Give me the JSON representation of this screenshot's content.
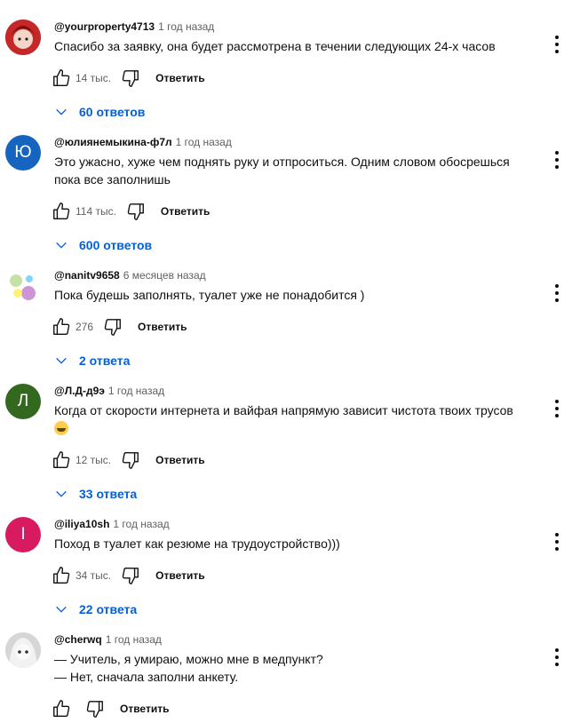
{
  "ui": {
    "reply_label": "Ответить"
  },
  "colors": {
    "link": "#065fd4",
    "muted": "#606060"
  },
  "comments": [
    {
      "author": "@yourproperty4713",
      "time": "1 год назад",
      "text": "Спасибо за заявку, она будет рассмотрена в течении следующих 24-х часов",
      "likes": "14 тыс.",
      "replies": "60 ответов",
      "avatar_letter": "",
      "avatar_color": "#8b1a1a"
    },
    {
      "author": "@юлиянемыкина-ф7л",
      "time": "1 год назад",
      "text": "Это ужасно, хуже чем поднять руку и отпроситься. Одним словом обосрешься пока все заполнишь",
      "likes": "114 тыс.",
      "replies": "600 ответов",
      "avatar_letter": "Ю",
      "avatar_color": "#1565c0"
    },
    {
      "author": "@nanitv9658",
      "time": "6 месяцев назад",
      "text": "Пока будешь заполнять, туалет уже не понадобится )",
      "likes": "276",
      "replies": "2 ответа",
      "avatar_letter": "",
      "avatar_color": "#ffffff"
    },
    {
      "author": "@Л.Д-д9э",
      "time": "1 год назад",
      "text": "Когда от скорости интернета и вайфая напрямую зависит чистота твоих трусов",
      "likes": "12 тыс.",
      "replies": "33 ответа",
      "avatar_letter": "Л",
      "avatar_color": "#33691e"
    },
    {
      "author": "@iliya10sh",
      "time": "1 год назад",
      "text": "Поход в туалет как резюме на трудоустройство)))",
      "likes": "34 тыс.",
      "replies": "22 ответа",
      "avatar_letter": "I",
      "avatar_color": "#d81b60"
    },
    {
      "author": "@cherwq",
      "time": "1 год назад",
      "text": "— Учитель, я умираю, можно мне в медпункт?\n— Нет, сначала заполни анкету.",
      "likes": "",
      "replies": "",
      "avatar_letter": "",
      "avatar_color": "#9e9e9e"
    }
  ]
}
